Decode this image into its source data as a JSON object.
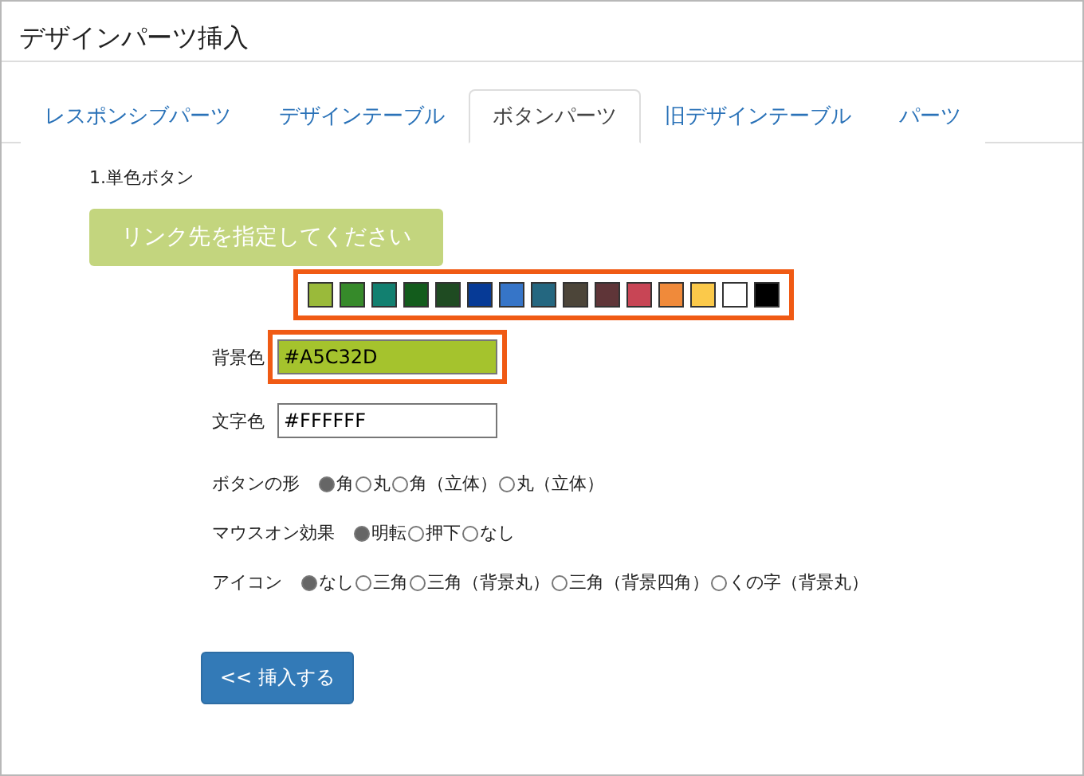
{
  "page_title": "デザインパーツ挿入",
  "tabs": [
    {
      "label": "レスポンシブパーツ",
      "selected": false
    },
    {
      "label": "デザインテーブル",
      "selected": false
    },
    {
      "label": "ボタンパーツ",
      "selected": true
    },
    {
      "label": "旧デザインテーブル",
      "selected": false
    },
    {
      "label": "パーツ",
      "selected": false
    }
  ],
  "section_title": "1.単色ボタン",
  "preview_button": {
    "label": "リンク先を指定してください",
    "color": "#c3d57e"
  },
  "palette": {
    "highlighted": true,
    "swatches": [
      {
        "color": "#9aba3a"
      },
      {
        "color": "#368a2a"
      },
      {
        "color": "#128070"
      },
      {
        "color": "#135c1c"
      },
      {
        "color": "#1f4b22"
      },
      {
        "color": "#063a96"
      },
      {
        "color": "#3675c8"
      },
      {
        "color": "#246780"
      },
      {
        "color": "#4c4539"
      },
      {
        "color": "#5f3538"
      },
      {
        "color": "#c84555"
      },
      {
        "color": "#f08a3a"
      },
      {
        "color": "#fbc94a"
      },
      {
        "color": "#ffffff"
      },
      {
        "color": "#000000"
      }
    ]
  },
  "fields": [
    {
      "label": "背景色",
      "value": "#A5C32D",
      "color": "#a5c32d",
      "highlighted": true
    },
    {
      "label": "文字色",
      "value": "#FFFFFF",
      "color": "#ffffff",
      "highlighted": false
    }
  ],
  "radio_groups": [
    {
      "label": "ボタンの形",
      "options": [
        {
          "label": "角",
          "selected": true
        },
        {
          "label": "丸",
          "selected": false
        },
        {
          "label": "角（立体）",
          "selected": false
        },
        {
          "label": "丸（立体）",
          "selected": false
        }
      ]
    },
    {
      "label": "マウスオン効果",
      "options": [
        {
          "label": "明転",
          "selected": true
        },
        {
          "label": "押下",
          "selected": false
        },
        {
          "label": "なし",
          "selected": false
        }
      ]
    },
    {
      "label": "アイコン",
      "options": [
        {
          "label": "なし",
          "selected": true
        },
        {
          "label": "三角",
          "selected": false
        },
        {
          "label": "三角（背景丸）",
          "selected": false
        },
        {
          "label": "三角（背景四角）",
          "selected": false
        },
        {
          "label": "くの字（背景丸）",
          "selected": false
        }
      ]
    }
  ],
  "insert_button": "<< 挿入する"
}
